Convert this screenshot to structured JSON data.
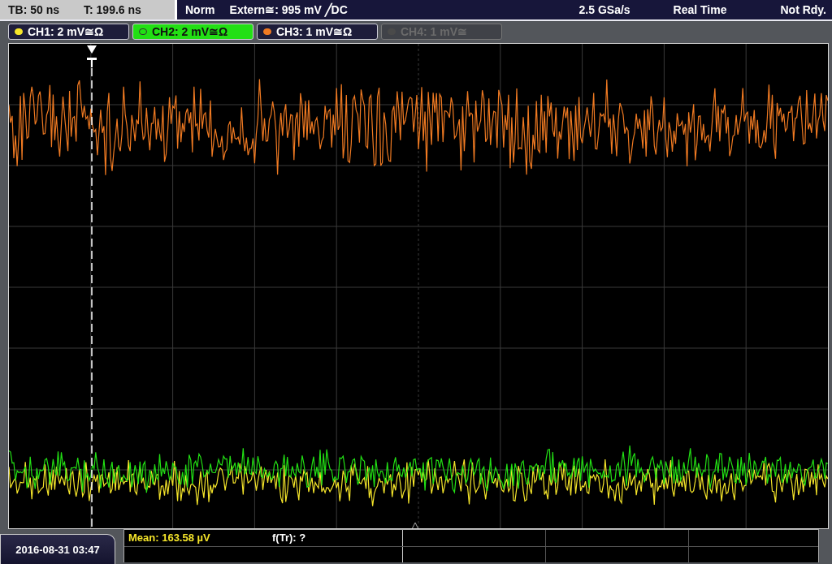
{
  "header": {
    "timebase": "TB: 50 ns",
    "trigger_time": "T: 199.6 ns",
    "mode": "Norm",
    "trigger": "Extern≅: 995 mV ╱DC",
    "sample_rate": "2.5 GSa/s",
    "acquisition": "Real Time",
    "state": "Not Rdy."
  },
  "channels": [
    {
      "label": "CH1: 2 mV≅Ω",
      "color": "#f5e52a",
      "selected": false,
      "disabled": false
    },
    {
      "label": "CH2: 2 mV≅Ω",
      "color": "#22e014",
      "selected": true,
      "disabled": false
    },
    {
      "label": "CH3: 1 mV≅Ω",
      "color": "#f07a22",
      "selected": false,
      "disabled": false
    },
    {
      "label": "CH4: 1 mV≅",
      "color": "#4a4a4a",
      "selected": false,
      "disabled": true
    }
  ],
  "footer": {
    "date": "2016-08-31 03:47"
  },
  "measurements": [
    {
      "text": "Mean: 163.58 µV",
      "color": "#f5e52a"
    },
    {
      "text": "f(Tr): ?",
      "color": "#ffffff"
    }
  ]
}
